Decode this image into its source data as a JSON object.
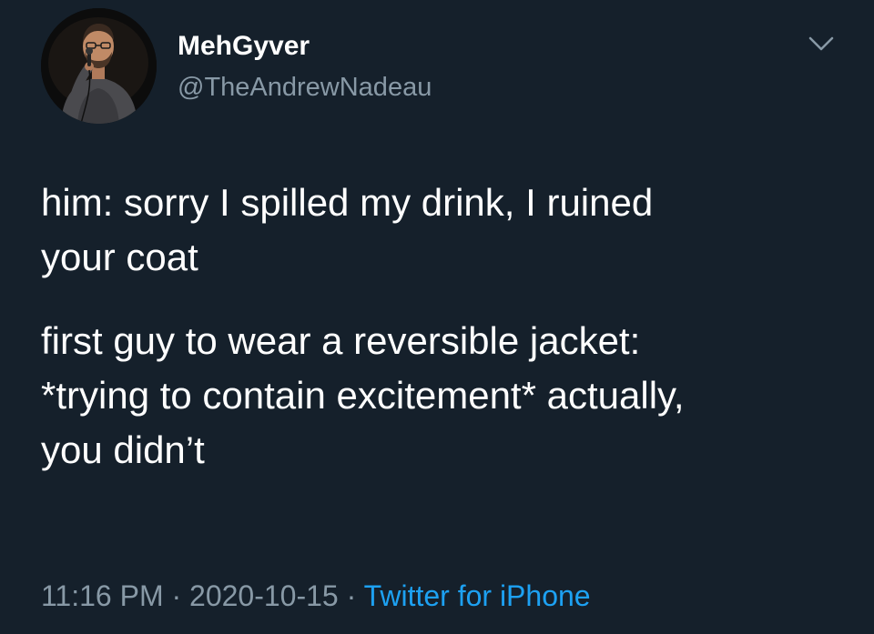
{
  "tweet": {
    "display_name": "MehGyver",
    "handle": "@TheAndrewNadeau",
    "paragraphs": [
      "him: sorry I spilled my drink, I ruined\nyour coat",
      "first guy to wear a reversible jacket:\n*trying to contain excitement* actually,\nyou didn’t"
    ],
    "time": "11:16 PM",
    "separator": "·",
    "date": "2020-10-15",
    "source": "Twitter for iPhone"
  },
  "icons": {
    "avatar": "profile-photo",
    "menu": "chevron-down-icon"
  },
  "colors": {
    "background": "#15202b",
    "text": "#ffffff",
    "secondary": "#8899a6",
    "link": "#1da1f2"
  }
}
